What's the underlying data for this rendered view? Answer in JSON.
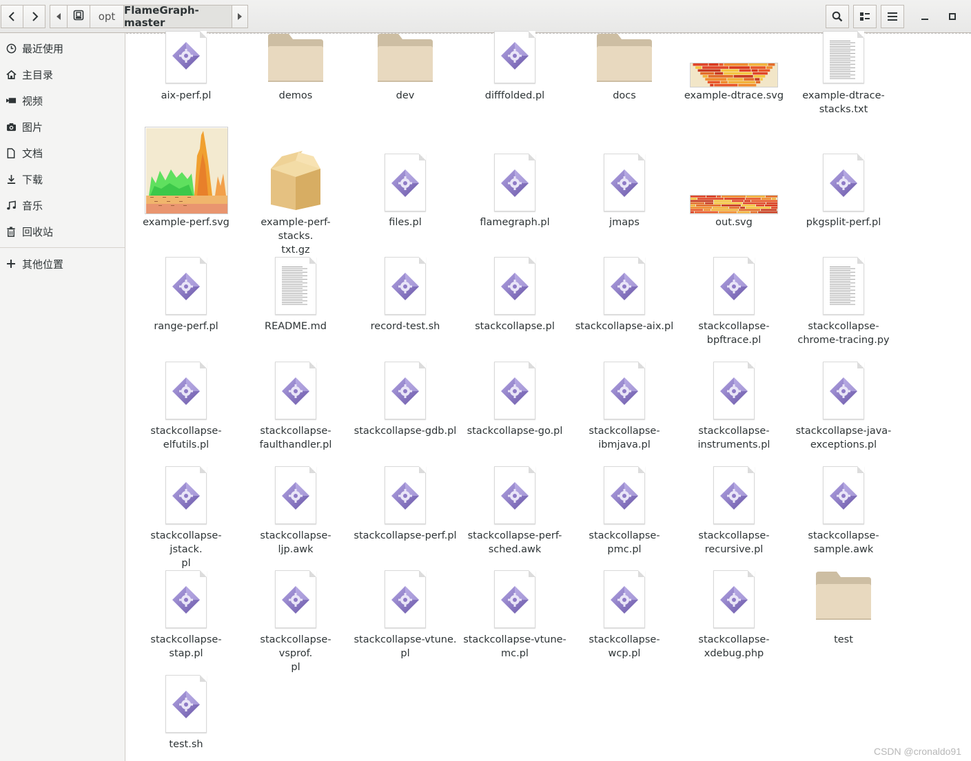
{
  "header": {
    "back_icon": "chevron-left-icon",
    "forward_icon": "chevron-right-icon",
    "path_prev_icon": "triangle-left-icon",
    "path_next_icon": "triangle-right-icon",
    "path": [
      "opt",
      "FlameGraph-master"
    ],
    "search_icon": "search-icon",
    "view_icon": "list-view-icon",
    "menu_icon": "hamburger-menu-icon",
    "minimize_icon": "minimize-icon",
    "maximize_icon": "maximize-icon"
  },
  "sidebar": {
    "items": [
      {
        "label": "最近使用",
        "icon": "clock-icon"
      },
      {
        "label": "主目录",
        "icon": "home-icon"
      },
      {
        "label": "视频",
        "icon": "video-icon"
      },
      {
        "label": "图片",
        "icon": "camera-icon"
      },
      {
        "label": "文档",
        "icon": "document-icon"
      },
      {
        "label": "下载",
        "icon": "download-icon"
      },
      {
        "label": "音乐",
        "icon": "music-icon"
      },
      {
        "label": "回收站",
        "icon": "trash-icon"
      }
    ],
    "other": {
      "label": "其他位置",
      "icon": "plus-icon"
    }
  },
  "files": [
    {
      "name": "aix-perf.pl",
      "kind": "script"
    },
    {
      "name": "demos",
      "kind": "folder"
    },
    {
      "name": "dev",
      "kind": "folder"
    },
    {
      "name": "difffolded.pl",
      "kind": "script"
    },
    {
      "name": "docs",
      "kind": "folder"
    },
    {
      "name": "example-dtrace.svg",
      "kind": "svg-wide"
    },
    {
      "name": "example-dtrace-\nstacks.txt",
      "kind": "text"
    },
    {
      "name": "example-perf.svg",
      "kind": "svg-perf"
    },
    {
      "name": "example-perf-stacks.\ntxt.gz",
      "kind": "archive"
    },
    {
      "name": "files.pl",
      "kind": "script"
    },
    {
      "name": "flamegraph.pl",
      "kind": "script"
    },
    {
      "name": "jmaps",
      "kind": "script"
    },
    {
      "name": "out.svg",
      "kind": "svg-out"
    },
    {
      "name": "pkgsplit-perf.pl",
      "kind": "script"
    },
    {
      "name": "range-perf.pl",
      "kind": "script"
    },
    {
      "name": "README.md",
      "kind": "text"
    },
    {
      "name": "record-test.sh",
      "kind": "script"
    },
    {
      "name": "stackcollapse.pl",
      "kind": "script"
    },
    {
      "name": "stackcollapse-aix.pl",
      "kind": "script"
    },
    {
      "name": "stackcollapse-\nbpftrace.pl",
      "kind": "script"
    },
    {
      "name": "stackcollapse-\nchrome-tracing.py",
      "kind": "text"
    },
    {
      "name": "stackcollapse-\nelfutils.pl",
      "kind": "script"
    },
    {
      "name": "stackcollapse-\nfaulthandler.pl",
      "kind": "script"
    },
    {
      "name": "stackcollapse-gdb.pl",
      "kind": "script"
    },
    {
      "name": "stackcollapse-go.pl",
      "kind": "script"
    },
    {
      "name": "stackcollapse-\nibmjava.pl",
      "kind": "script"
    },
    {
      "name": "stackcollapse-\ninstruments.pl",
      "kind": "script"
    },
    {
      "name": "stackcollapse-java-\nexceptions.pl",
      "kind": "script"
    },
    {
      "name": "stackcollapse-jstack.\npl",
      "kind": "script"
    },
    {
      "name": "stackcollapse-ljp.awk",
      "kind": "script"
    },
    {
      "name": "stackcollapse-perf.pl",
      "kind": "script"
    },
    {
      "name": "stackcollapse-perf-\nsched.awk",
      "kind": "script"
    },
    {
      "name": "stackcollapse-pmc.pl",
      "kind": "script"
    },
    {
      "name": "stackcollapse-\nrecursive.pl",
      "kind": "script"
    },
    {
      "name": "stackcollapse-\nsample.awk",
      "kind": "script"
    },
    {
      "name": "stackcollapse-stap.pl",
      "kind": "script"
    },
    {
      "name": "stackcollapse-vsprof.\npl",
      "kind": "script"
    },
    {
      "name": "stackcollapse-vtune.\npl",
      "kind": "script"
    },
    {
      "name": "stackcollapse-vtune-\nmc.pl",
      "kind": "script"
    },
    {
      "name": "stackcollapse-wcp.pl",
      "kind": "script"
    },
    {
      "name": "stackcollapse-\nxdebug.php",
      "kind": "script"
    },
    {
      "name": "test",
      "kind": "folder"
    },
    {
      "name": "test.sh",
      "kind": "script"
    }
  ],
  "watermark": "CSDN @cronaldo91",
  "colors": {
    "folder": "#e8d9bf",
    "folder_tab": "#cdbea3",
    "gem": "#8f7bc6"
  }
}
